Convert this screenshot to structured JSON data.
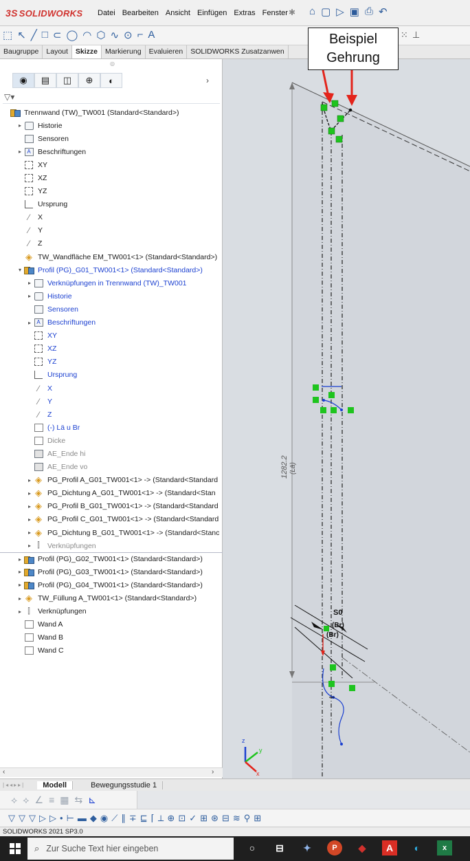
{
  "app": {
    "logo_text": "SOLIDWORKS",
    "logo_prefix": "3S",
    "menu": [
      "Datei",
      "Bearbeiten",
      "Ansicht",
      "Einfügen",
      "Extras",
      "Fenster"
    ]
  },
  "command_tabs": [
    "Baugruppe",
    "Layout",
    "Skizze",
    "Markierung",
    "Evaluieren",
    "SOLIDWORKS Zusatzanwen"
  ],
  "active_command_tab": "Skizze",
  "callout": {
    "line1": "Beispiel",
    "line2": "Gehrung"
  },
  "tree": [
    {
      "label": "Trennwand (TW)_TW001  (Standard<Standard>)",
      "icon": "assembly-icon",
      "indent": 0,
      "expander": "",
      "color": "normal"
    },
    {
      "label": "Historie",
      "icon": "history-icon",
      "indent": 1,
      "expander": "▸",
      "color": "normal"
    },
    {
      "label": "Sensoren",
      "icon": "sensor-icon",
      "indent": 1,
      "expander": "",
      "color": "normal"
    },
    {
      "label": "Beschriftungen",
      "icon": "annotations-icon",
      "indent": 1,
      "expander": "▸",
      "color": "normal"
    },
    {
      "label": "XY",
      "icon": "plane-icon",
      "indent": 1,
      "expander": "",
      "color": "normal"
    },
    {
      "label": "XZ",
      "icon": "plane-icon",
      "indent": 1,
      "expander": "",
      "color": "normal"
    },
    {
      "label": "YZ",
      "icon": "plane-icon",
      "indent": 1,
      "expander": "",
      "color": "normal"
    },
    {
      "label": "Ursprung",
      "icon": "origin-icon",
      "indent": 1,
      "expander": "",
      "color": "normal"
    },
    {
      "label": "X",
      "icon": "axis-icon",
      "indent": 1,
      "expander": "",
      "color": "normal"
    },
    {
      "label": "Y",
      "icon": "axis-icon",
      "indent": 1,
      "expander": "",
      "color": "normal"
    },
    {
      "label": "Z",
      "icon": "axis-icon",
      "indent": 1,
      "expander": "",
      "color": "normal"
    },
    {
      "label": "TW_Wandfläche EM_TW001<1> (Standard<Standard>)",
      "icon": "part-icon",
      "indent": 1,
      "expander": "",
      "color": "normal"
    },
    {
      "label": "Profil (PG)_G01_TW001<1> (Standard<Standard>)",
      "icon": "assembly-icon",
      "indent": 1,
      "expander": "▾",
      "color": "blue"
    },
    {
      "label": "Verknüpfungen in Trennwand (TW)_TW001",
      "icon": "mates-folder-icon",
      "indent": 2,
      "expander": "▸",
      "color": "blue"
    },
    {
      "label": "Historie",
      "icon": "history-icon",
      "indent": 2,
      "expander": "▸",
      "color": "blue"
    },
    {
      "label": "Sensoren",
      "icon": "sensor-icon",
      "indent": 2,
      "expander": "",
      "color": "blue"
    },
    {
      "label": "Beschriftungen",
      "icon": "annotations-icon",
      "indent": 2,
      "expander": "▸",
      "color": "blue"
    },
    {
      "label": "XY",
      "icon": "plane-icon",
      "indent": 2,
      "expander": "",
      "color": "blue"
    },
    {
      "label": "XZ",
      "icon": "plane-icon",
      "indent": 2,
      "expander": "",
      "color": "blue"
    },
    {
      "label": "YZ",
      "icon": "plane-icon",
      "indent": 2,
      "expander": "",
      "color": "blue"
    },
    {
      "label": "Ursprung",
      "icon": "origin-icon",
      "indent": 2,
      "expander": "",
      "color": "blue"
    },
    {
      "label": "X",
      "icon": "axis-icon",
      "indent": 2,
      "expander": "",
      "color": "blue"
    },
    {
      "label": "Y",
      "icon": "axis-icon",
      "indent": 2,
      "expander": "",
      "color": "blue"
    },
    {
      "label": "Z",
      "icon": "axis-icon",
      "indent": 2,
      "expander": "",
      "color": "blue"
    },
    {
      "label": "(-) Lä u Br",
      "icon": "sketch-icon",
      "indent": 2,
      "expander": "",
      "color": "blue"
    },
    {
      "label": "Dicke",
      "icon": "sketch-icon",
      "indent": 2,
      "expander": "",
      "color": "gray"
    },
    {
      "label": "AE_Ende hi",
      "icon": "feature-icon",
      "indent": 2,
      "expander": "",
      "color": "gray"
    },
    {
      "label": "AE_Ende vo",
      "icon": "feature-icon",
      "indent": 2,
      "expander": "",
      "color": "gray"
    },
    {
      "label": "PG_Profil A_G01_TW001<1> -> (Standard<Standard",
      "icon": "part-icon",
      "indent": 2,
      "expander": "▸",
      "color": "normal"
    },
    {
      "label": "PG_Dichtung A_G01_TW001<1> -> (Standard<Stan",
      "icon": "part-icon",
      "indent": 2,
      "expander": "▸",
      "color": "normal"
    },
    {
      "label": "PG_Profil B_G01_TW001<1> -> (Standard<Standard",
      "icon": "part-icon",
      "indent": 2,
      "expander": "▸",
      "color": "normal"
    },
    {
      "label": "PG_Profil C_G01_TW001<1> -> (Standard<Standard",
      "icon": "part-icon",
      "indent": 2,
      "expander": "▸",
      "color": "normal"
    },
    {
      "label": "PG_Dichtung B_G01_TW001<1> -> (Standard<Stanc",
      "icon": "part-icon",
      "indent": 2,
      "expander": "▸",
      "color": "normal"
    },
    {
      "label": "Verknüpfungen",
      "icon": "mates-icon",
      "indent": 2,
      "expander": "▸",
      "color": "gray"
    },
    {
      "label": "Profil (PG)_G02_TW001<1> (Standard<Standard>)",
      "icon": "assembly-icon",
      "indent": 1,
      "expander": "▸",
      "color": "normal"
    },
    {
      "label": "Profil (PG)_G03_TW001<1> (Standard<Standard>)",
      "icon": "assembly-icon",
      "indent": 1,
      "expander": "▸",
      "color": "normal"
    },
    {
      "label": "Profil (PG)_G04_TW001<1> (Standard<Standard>)",
      "icon": "assembly-icon",
      "indent": 1,
      "expander": "▸",
      "color": "normal"
    },
    {
      "label": "TW_Füllung A_TW001<1> (Standard<Standard>)",
      "icon": "part-icon",
      "indent": 1,
      "expander": "▸",
      "color": "normal"
    },
    {
      "label": "Verknüpfungen",
      "icon": "mates-icon",
      "indent": 1,
      "expander": "▸",
      "color": "normal"
    },
    {
      "label": "Wand A",
      "icon": "sketch-icon",
      "indent": 1,
      "expander": "",
      "color": "normal"
    },
    {
      "label": "Wand B",
      "icon": "sketch-icon",
      "indent": 1,
      "expander": "",
      "color": "normal"
    },
    {
      "label": "Wand C",
      "icon": "sketch-icon",
      "indent": 1,
      "expander": "",
      "color": "normal"
    }
  ],
  "graphics": {
    "dim_value": "1282.2",
    "dim_sub": "(Lä)",
    "label_s0": "S0",
    "label_br1": "(Br)",
    "label_br2": "(Br)",
    "triad_x": "x",
    "triad_y": "y",
    "triad_z": "z"
  },
  "motion_tabs": [
    "Modell",
    "Bewegungsstudie 1"
  ],
  "status_text": "SOLIDWORKS 2021 SP3.0",
  "taskbar": {
    "search_placeholder": "Zur Suche Text hier eingeben"
  },
  "colors": {
    "sketch_blue": "#1a3fd0",
    "relation_green": "#1ec41e",
    "arrow_red": "#e3241b"
  }
}
